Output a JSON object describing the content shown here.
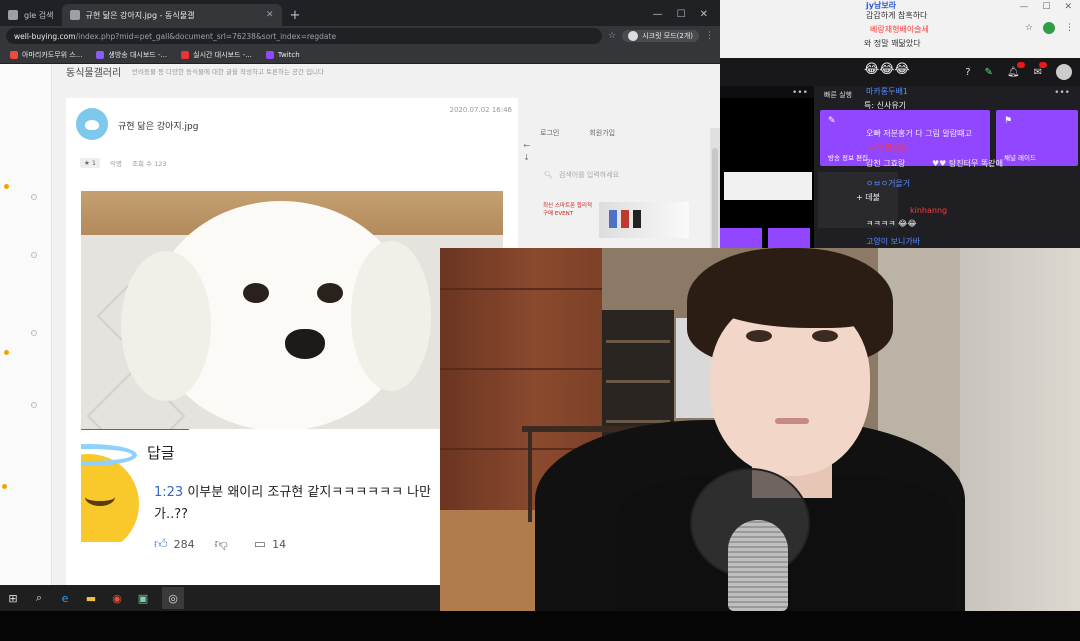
{
  "browser": {
    "tabs": [
      {
        "label": "gle 검색"
      },
      {
        "label": "규현 닮은 강아지.jpg - 동식물갤"
      }
    ],
    "new_tab": "+",
    "window_controls": [
      "—",
      "☐",
      "✕"
    ],
    "url_domain": "well-buying.com",
    "url_path": "/index.php?mid=pet_gall&document_srl=76238&sort_index=regdate",
    "profile": "시크릿 모드(2개)",
    "bookmarks": [
      {
        "label": "아마리카도무위 스...",
        "color": "#e84d3d"
      },
      {
        "label": "생방송 대시보드 -...",
        "color": "#8a5cf6"
      },
      {
        "label": "실시간 대시보드 -...",
        "color": "#e33"
      },
      {
        "label": "Twitch",
        "color": "#9147ff"
      }
    ]
  },
  "page": {
    "board_title": "동식물갤러리",
    "board_subtitle": "반려동물 등 다양한 동식물에 대한 글을 작성하고 토론하는 공간 입니다",
    "tab_login": "로그인",
    "tab_signup": "회원가입",
    "search_placeholder": "검색어를 입력하세요",
    "ad_text": "최신 스마트폰 합리적 구매 EVENT",
    "post": {
      "title": "규현 닮은 강아지.jpg",
      "date": "2020.07.02 16:46",
      "badge": "★ 1",
      "author": "익명",
      "views": "조회 수 123"
    },
    "comment": {
      "heading": "답글",
      "timestamp": "1:23",
      "text_line1": " 이부분 왜이리 조규현 같지ㅋㅋㅋㅋㅋㅋ 나만",
      "text_line2": "가..??",
      "likes": "284",
      "replies": "14"
    }
  },
  "stream": {
    "quick_title": "빠른 실행",
    "menu_dots": "•••",
    "tiles": [
      {
        "label": "방송 정보 편집",
        "icon": "✎"
      },
      {
        "label": "채널 레이드",
        "icon": "⚑"
      }
    ],
    "chat": [
      {
        "text": "jy남보라",
        "kind": "name"
      },
      {
        "text": "갑갑하게 참혹하다",
        "kind": "dark"
      },
      {
        "text": "베랑재형배이슬세",
        "kind": "red"
      },
      {
        "text": "와 정말 꽤닮았다",
        "kind": "dark"
      },
      {
        "text": "😂😂😂",
        "kind": "white"
      },
      {
        "text": "마카롱두배1",
        "kind": "blue"
      },
      {
        "text": "특: 신사유기",
        "kind": "white"
      },
      {
        "text": "오빠 저분홍거 다 그림 알람떄고",
        "kind": "white"
      },
      {
        "text": "나무안된삼",
        "kind": "red"
      },
      {
        "text": "감천 그효랑 ",
        "kind": "white"
      },
      {
        "text": "♥♥ 탕진터무 똑같애",
        "kind": "white"
      },
      {
        "text": "ㅇㅂㅇ거을거",
        "kind": "blue"
      },
      {
        "text": "+ 데불",
        "kind": "white"
      },
      {
        "text": "kinhanng",
        "kind": "red"
      },
      {
        "text": "ㅋㅋㅋㅋ 😂😂",
        "kind": "white"
      },
      {
        "text": "고양이 보니가바",
        "kind": "blue"
      }
    ]
  },
  "taskbar": {
    "items": [
      "windows-icon",
      "search-icon",
      "edge-icon",
      "explorer-icon",
      "chrome-icon",
      "app-icon",
      "obs-icon"
    ]
  }
}
